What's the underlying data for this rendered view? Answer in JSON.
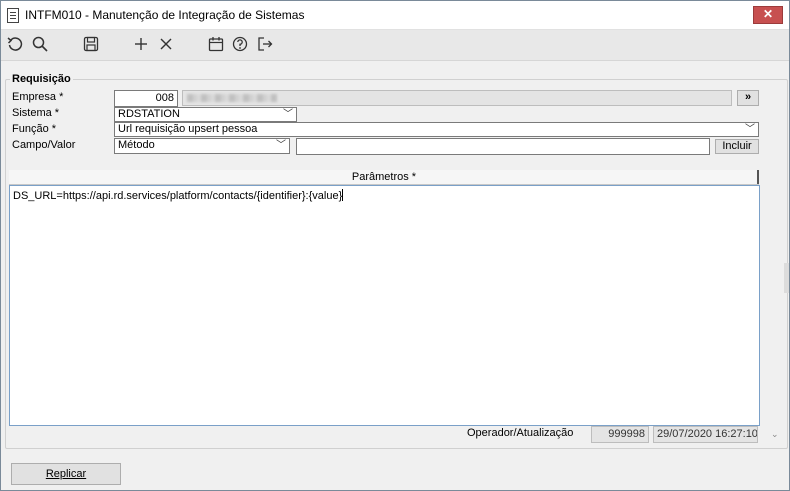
{
  "window": {
    "title": "INTFM010 - Manutenção de Integração de Sistemas",
    "close_label": "✕"
  },
  "toolbar": {
    "undo_icon": "undo-icon",
    "search_icon": "search-icon",
    "save_icon": "save-icon",
    "add_icon": "plus-icon",
    "delete_icon": "close-icon",
    "calendar_icon": "calendar-icon",
    "help_icon": "help-icon",
    "exit_icon": "exit-icon"
  },
  "form": {
    "group_title": "Requisição",
    "empresa": {
      "label": "Empresa *",
      "code": "008",
      "lookup_label": "»"
    },
    "sistema": {
      "label": "Sistema *",
      "value": "RDSTATION"
    },
    "funcao": {
      "label": "Função *",
      "value": "Url requisição upsert pessoa"
    },
    "campo_valor": {
      "label": "Campo/Valor",
      "select_value": "Método",
      "text_value": "",
      "include_label": "Incluir"
    },
    "parametros": {
      "header": "Parâmetros *",
      "value": "DS_URL=https://api.rd.services/platform/contacts/{identifier}:{value}"
    },
    "operador": {
      "label": "Operador/Atualização",
      "code": "999998",
      "datetime": "29/07/2020 16:27:10"
    }
  },
  "footer": {
    "replicar_label": "Replicar"
  }
}
